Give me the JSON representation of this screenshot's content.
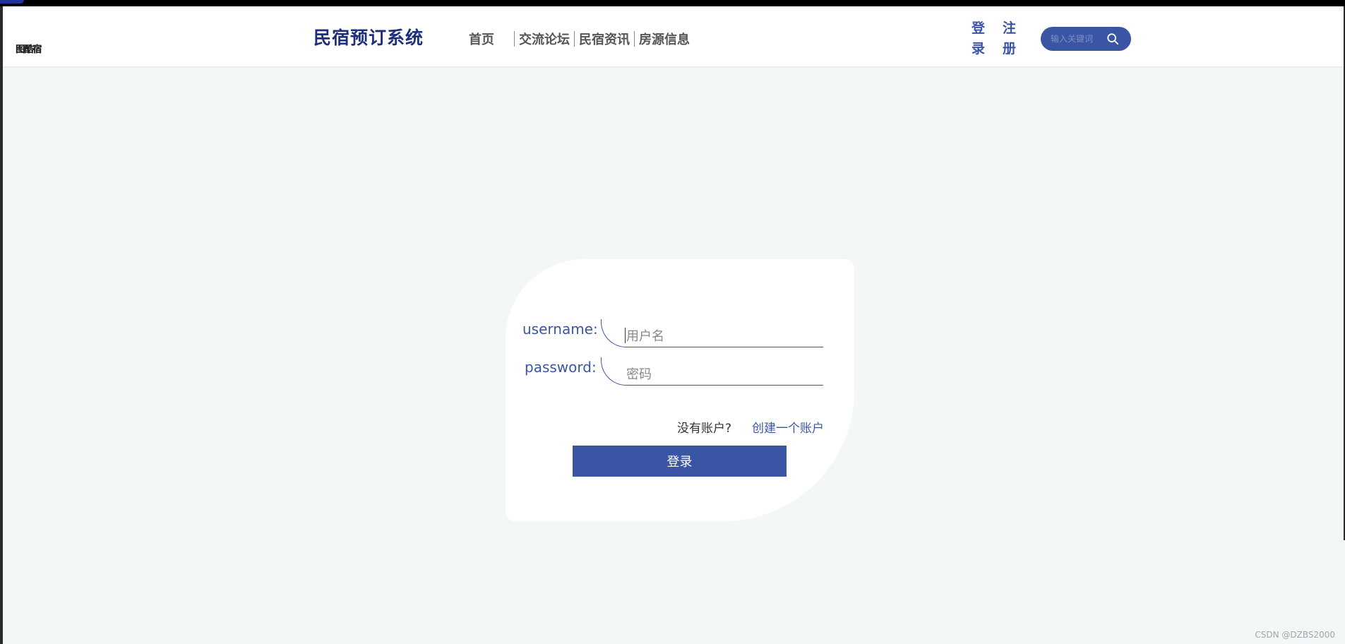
{
  "header": {
    "logo_text": "图酷宿",
    "site_title": "民宿预订系统",
    "nav": [
      "首页",
      "交流论坛",
      "民宿资讯",
      "房源信息"
    ],
    "login_label": [
      "登",
      "录"
    ],
    "register_label": [
      "注",
      "册"
    ],
    "search_placeholder": "输入关键词"
  },
  "login_form": {
    "username_label": "username:",
    "username_placeholder": "用户名",
    "password_label": "password:",
    "password_placeholder": "密码",
    "no_account_text": "没有账户?",
    "create_account_link": "创建一个账户",
    "submit_label": "登录"
  },
  "watermark": "CSDN @DZBS2000",
  "colors": {
    "primary": "#3a55a4",
    "title": "#1d2f7a",
    "background": "#f3f7f7"
  }
}
